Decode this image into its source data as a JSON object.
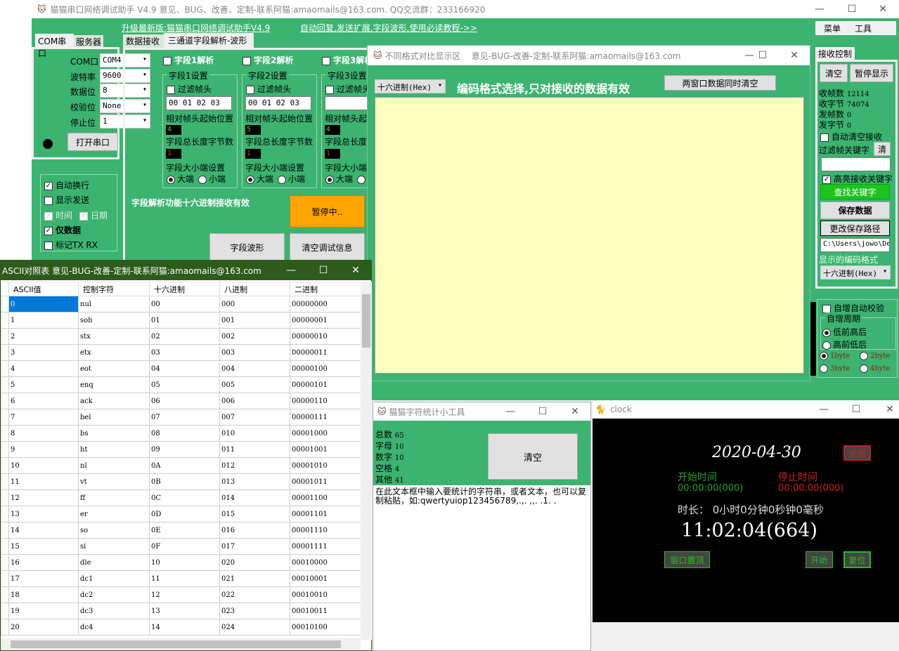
{
  "main": {
    "title": "猫猫串口网络调试助手 V4.9 意见、BUG、改善、定制-联系阿猫:amaomails@163.com. QQ交流群：233166920",
    "link_upgrade": "升级最新版:猫猫串口网络调试助手V4.9",
    "link_help": "自动回复,发送扩展,字段波形,使用必读教程->>",
    "menu": [
      "菜单",
      "工具"
    ],
    "left_tabs": [
      "COM串口",
      "服务器"
    ],
    "com": {
      "labels": [
        "COM口",
        "波特率",
        "数据位",
        "校验位",
        "停止位"
      ],
      "values": [
        "COM4",
        "9600",
        "8",
        "None",
        "1"
      ],
      "open_button": "打开串口"
    },
    "options": [
      {
        "label": "自动换行",
        "checked": true
      },
      {
        "label": "显示发送",
        "checked": false
      },
      {
        "label": "时间",
        "checked": true
      },
      {
        "label": "日期",
        "checked": true
      },
      {
        "label": "仅数据",
        "checked": true
      },
      {
        "label": "标记TX RX",
        "checked": false
      }
    ],
    "mid_tabs": [
      "数据接收",
      "三通道字段解析-波形"
    ],
    "fields": [
      {
        "enable": "字段1解析",
        "checked": true,
        "group": "字段1设置",
        "filter": "过滤帧头",
        "header": "00 01 02 03",
        "start_label": "相对帧头起始位置",
        "start": "4",
        "len_label": "字段总长度字节数",
        "len": "1",
        "endian_label": "字段大小端设置",
        "big": "大端",
        "little": "小端"
      },
      {
        "enable": "字段2解析",
        "checked": false,
        "group": "字段2设置",
        "filter": "过滤帧头",
        "header": "00 01 02 03",
        "start_label": "相对帧头起始位置",
        "start": "5",
        "len_label": "字段总长度字节数",
        "len": "1",
        "endian_label": "字段大小端设置",
        "big": "大端",
        "little": "小端"
      },
      {
        "enable": "字段3解析",
        "checked": false,
        "group": "字段3设置",
        "filter": "过滤帧头",
        "header": "",
        "start_label": "相对帧头起始位置",
        "start": "4",
        "len_label": "字段总长度字节数",
        "len": "1",
        "endian_label": "字段大小端设置",
        "big": "大端",
        "little": "小端"
      }
    ],
    "field_note": "字段解析功能十六进制接收有效",
    "pause_button": "暂停中..",
    "wave_button": "字段波形",
    "clear_debug_button": "清空调试信息",
    "recv": {
      "tab": "接收控制",
      "clear": "清空",
      "pause": "暂停显示",
      "stats": [
        [
          "收帧数",
          "12114"
        ],
        [
          "收字节",
          "74074"
        ],
        [
          "发帧数",
          "0"
        ],
        [
          "发字节",
          "0"
        ]
      ],
      "auto_clear": "自动清空接收",
      "filter_kw": "过滤帧关键字",
      "filter_clear": "清",
      "highlight": "高亮接收关键字",
      "find": "查找关键字",
      "save": "保存数据",
      "change_path": "更改保存路径",
      "path": "C:\\Users\\jowo\\De",
      "enc_label": "显示的编码格式",
      "enc": "十六进制(Hex)"
    },
    "auto": {
      "check": "自增自动校验",
      "group": "自增周期",
      "lo_hi": "低前高后",
      "hi_lo": "高前低后",
      "bytes": [
        "1byte",
        "2byte",
        "3byte",
        "4byte"
      ]
    }
  },
  "compare": {
    "title": "不同格式对比显示区    意见-BUG-改善-定制-联系阿猫:amaomails@163.com",
    "enc": "十六进制(Hex)",
    "note": "编码格式选择,只对接收的数据有效",
    "clear_both": "两窗口数据同时清空"
  },
  "ascii": {
    "title": "ASCII对照表 意见-BUG-改善-定制-联系阿猫:amaomails@163.com",
    "headers": [
      "ASCII值",
      "控制字符",
      "十六进制",
      "八进制",
      "二进制"
    ],
    "rows": [
      [
        "0",
        "nul",
        "00",
        "000",
        "00000000"
      ],
      [
        "1",
        "soh",
        "01",
        "001",
        "00000001"
      ],
      [
        "2",
        "stx",
        "02",
        "002",
        "00000010"
      ],
      [
        "3",
        "etx",
        "03",
        "003",
        "00000011"
      ],
      [
        "4",
        "eot",
        "04",
        "004",
        "00000100"
      ],
      [
        "5",
        "enq",
        "05",
        "005",
        "00000101"
      ],
      [
        "6",
        "ack",
        "06",
        "006",
        "00000110"
      ],
      [
        "7",
        "bel",
        "07",
        "007",
        "00000111"
      ],
      [
        "8",
        "bs",
        "08",
        "010",
        "00001000"
      ],
      [
        "9",
        "ht",
        "09",
        "011",
        "00001001"
      ],
      [
        "10",
        "nl",
        "0A",
        "012",
        "00001010"
      ],
      [
        "11",
        "vt",
        "0B",
        "013",
        "00001011"
      ],
      [
        "12",
        "ff",
        "0C",
        "014",
        "00001100"
      ],
      [
        "13",
        "er",
        "0D",
        "015",
        "00001101"
      ],
      [
        "14",
        "so",
        "0E",
        "016",
        "00001110"
      ],
      [
        "15",
        "si",
        "0F",
        "017",
        "00001111"
      ],
      [
        "16",
        "dle",
        "10",
        "020",
        "00010000"
      ],
      [
        "17",
        "dc1",
        "11",
        "021",
        "00010001"
      ],
      [
        "18",
        "dc2",
        "12",
        "022",
        "00010010"
      ],
      [
        "19",
        "dc3",
        "13",
        "023",
        "00010011"
      ],
      [
        "20",
        "dc4",
        "14",
        "024",
        "00010100"
      ]
    ]
  },
  "stats": {
    "title": "猫猫字符统计小工具",
    "items": [
      [
        "总数",
        "65"
      ],
      [
        "字母",
        "10"
      ],
      [
        "数字",
        "10"
      ],
      [
        "空格",
        "4"
      ],
      [
        "其他",
        "41"
      ]
    ],
    "clear": "清空",
    "text": "在此文本框中输入要统计的字符串，或者文本，也可以复制粘贴，如:qwertyuiop123456789,.,.  ,,. .1. ."
  },
  "clock": {
    "title": "clock",
    "date": "2020-04-30",
    "close": "关闭",
    "start_label": "开始时间",
    "start": "00:00:00(000)",
    "stop_label": "停止时间",
    "stop": "00:00:00(000)",
    "duration": "时长： 0小时0分钟0秒钟0毫秒",
    "time": "11:02:04(664)",
    "pin": "窗口置顶",
    "start_btn": "开始",
    "reset": "复位"
  }
}
